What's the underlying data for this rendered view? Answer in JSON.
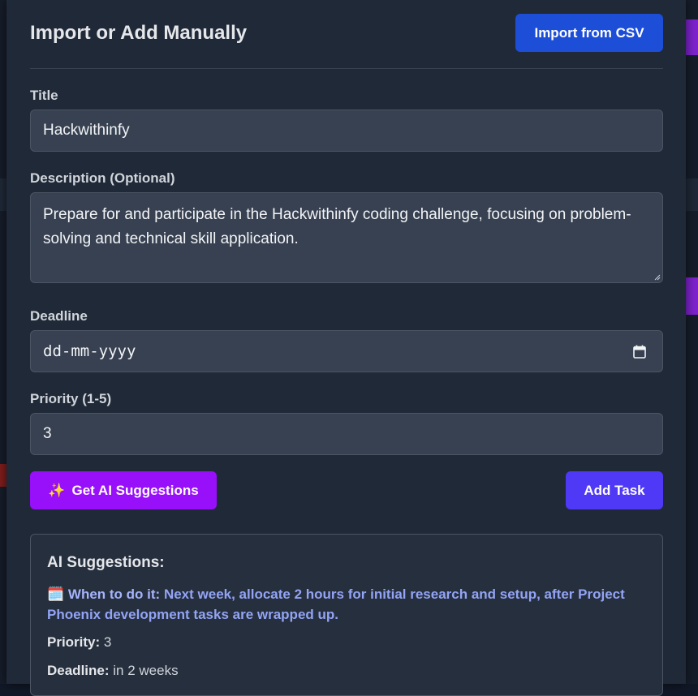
{
  "modal": {
    "title": "Import or Add Manually",
    "import_csv_label": "Import from CSV"
  },
  "form": {
    "title_label": "Title",
    "title_value": "Hackwithinfy",
    "description_label": "Description (Optional)",
    "description_value": "Prepare for and participate in the Hackwithinfy coding challenge, focusing on problem-solving and technical skill application.",
    "deadline_label": "Deadline",
    "deadline_placeholder": "dd-mm-yyyy",
    "priority_label": "Priority (1-5)",
    "priority_value": "3"
  },
  "actions": {
    "ai_suggestions_icon": "✨",
    "ai_suggestions_label": "Get AI Suggestions",
    "add_task_label": "Add Task"
  },
  "suggestions": {
    "heading": "AI Suggestions:",
    "when_icon": "🗓️",
    "when_label": "When to do it:",
    "when_text": "Next week, allocate 2 hours for initial research and setup, after Project Phoenix development tasks are wrapped up.",
    "priority_label": "Priority:",
    "priority_value": "3",
    "deadline_label": "Deadline:",
    "deadline_value": "in 2 weeks"
  },
  "colors": {
    "panel_bg": "#1f2937",
    "field_bg": "#374151",
    "csv_button": "#1d4ed8",
    "ai_button": "#9810fa",
    "add_button": "#4f39f6",
    "suggestion_accent": "#a5b4fc"
  }
}
